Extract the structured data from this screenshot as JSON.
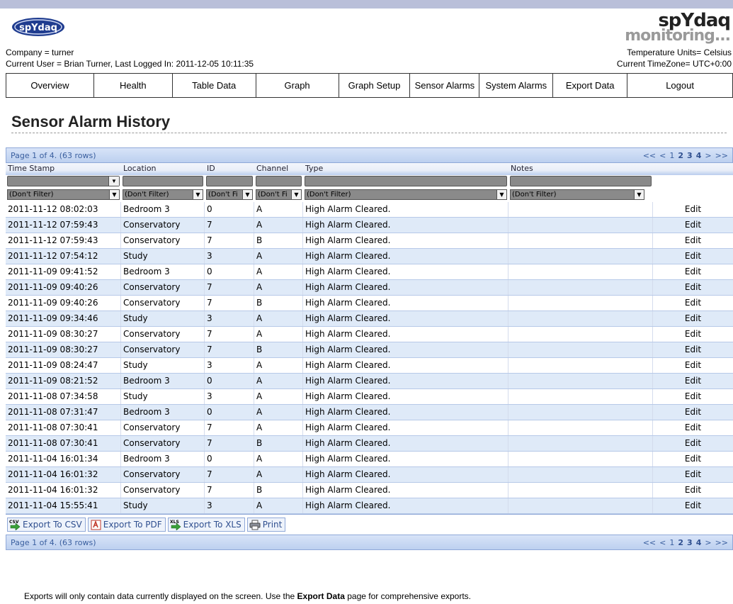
{
  "header": {
    "logo_text": "spYdaq",
    "brand_line1": "spYdaq",
    "brand_line2": "monitoring...",
    "company": "Company = turner",
    "current_user": "Current User = Brian Turner, Last Logged In: 2011-12-05 10:11:35",
    "temp_units": "Temperature Units= Celsius",
    "timezone": "Current TimeZone= UTC+0:00"
  },
  "nav": [
    "Overview",
    "Health",
    "Table Data",
    "Graph",
    "Graph Setup",
    "Sensor Alarms",
    "System Alarms",
    "Export Data",
    "Logout"
  ],
  "page_title": "Sensor Alarm History",
  "grid": {
    "page_info": "Page 1 of 4. (63 rows)",
    "pager": [
      "<<",
      "<",
      "1",
      "2",
      "3",
      "4",
      ">",
      ">>"
    ],
    "columns": [
      "Time Stamp",
      "Location",
      "ID",
      "Channel",
      "Type",
      "Notes",
      ""
    ],
    "filter_label": "(Don't Filter)",
    "filter_label_short": "(Don't Fi",
    "rows": [
      [
        "2011-11-12 08:02:03",
        "Bedroom 3",
        "0",
        "A",
        "High Alarm Cleared.",
        "",
        "Edit"
      ],
      [
        "2011-11-12 07:59:43",
        "Conservatory",
        "7",
        "A",
        "High Alarm Cleared.",
        "",
        "Edit"
      ],
      [
        "2011-11-12 07:59:43",
        "Conservatory",
        "7",
        "B",
        "High Alarm Cleared.",
        "",
        "Edit"
      ],
      [
        "2011-11-12 07:54:12",
        "Study",
        "3",
        "A",
        "High Alarm Cleared.",
        "",
        "Edit"
      ],
      [
        "2011-11-09 09:41:52",
        "Bedroom 3",
        "0",
        "A",
        "High Alarm Cleared.",
        "",
        "Edit"
      ],
      [
        "2011-11-09 09:40:26",
        "Conservatory",
        "7",
        "A",
        "High Alarm Cleared.",
        "",
        "Edit"
      ],
      [
        "2011-11-09 09:40:26",
        "Conservatory",
        "7",
        "B",
        "High Alarm Cleared.",
        "",
        "Edit"
      ],
      [
        "2011-11-09 09:34:46",
        "Study",
        "3",
        "A",
        "High Alarm Cleared.",
        "",
        "Edit"
      ],
      [
        "2011-11-09 08:30:27",
        "Conservatory",
        "7",
        "A",
        "High Alarm Cleared.",
        "",
        "Edit"
      ],
      [
        "2011-11-09 08:30:27",
        "Conservatory",
        "7",
        "B",
        "High Alarm Cleared.",
        "",
        "Edit"
      ],
      [
        "2011-11-09 08:24:47",
        "Study",
        "3",
        "A",
        "High Alarm Cleared.",
        "",
        "Edit"
      ],
      [
        "2011-11-09 08:21:52",
        "Bedroom 3",
        "0",
        "A",
        "High Alarm Cleared.",
        "",
        "Edit"
      ],
      [
        "2011-11-08 07:34:58",
        "Study",
        "3",
        "A",
        "High Alarm Cleared.",
        "",
        "Edit"
      ],
      [
        "2011-11-08 07:31:47",
        "Bedroom 3",
        "0",
        "A",
        "High Alarm Cleared.",
        "",
        "Edit"
      ],
      [
        "2011-11-08 07:30:41",
        "Conservatory",
        "7",
        "A",
        "High Alarm Cleared.",
        "",
        "Edit"
      ],
      [
        "2011-11-08 07:30:41",
        "Conservatory",
        "7",
        "B",
        "High Alarm Cleared.",
        "",
        "Edit"
      ],
      [
        "2011-11-04 16:01:34",
        "Bedroom 3",
        "0",
        "A",
        "High Alarm Cleared.",
        "",
        "Edit"
      ],
      [
        "2011-11-04 16:01:32",
        "Conservatory",
        "7",
        "A",
        "High Alarm Cleared.",
        "",
        "Edit"
      ],
      [
        "2011-11-04 16:01:32",
        "Conservatory",
        "7",
        "B",
        "High Alarm Cleared.",
        "",
        "Edit"
      ],
      [
        "2011-11-04 15:55:41",
        "Study",
        "3",
        "A",
        "High Alarm Cleared.",
        "",
        "Edit"
      ]
    ],
    "export_buttons": [
      {
        "label": "Export To CSV",
        "icon": "csv-export-icon",
        "icon_text": "CSV"
      },
      {
        "label": "Export To PDF",
        "icon": "pdf-icon",
        "icon_text": ""
      },
      {
        "label": "Export To XLS",
        "icon": "xls-export-icon",
        "icon_text": "XLS"
      },
      {
        "label": "Print",
        "icon": "printer-icon",
        "icon_text": ""
      }
    ]
  },
  "footer_note": {
    "before": "Exports will only contain data currently displayed on the screen. Use the ",
    "bold": "Export Data",
    "after": " page for comprehensive exports."
  },
  "colors": {
    "accent": "#3a5f9f",
    "row_alt": "#dfeaf8",
    "top_band": "#b9bfd9"
  }
}
